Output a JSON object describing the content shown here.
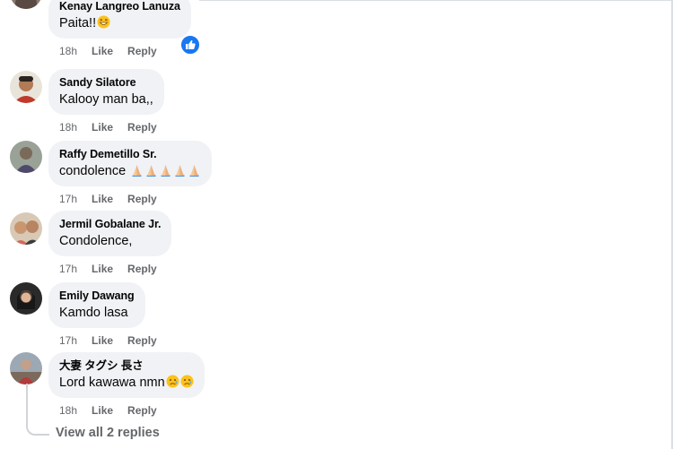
{
  "comments": [
    {
      "author": "Kenay Langreo Lanuza",
      "text": "Paita!!",
      "emoji": "grinning-sweat",
      "time": "18h",
      "like": "Like",
      "reply": "Reply",
      "reaction": "like-reaction"
    },
    {
      "author": "Sandy Silatore",
      "text": "Kalooy man ba,,",
      "time": "18h",
      "like": "Like",
      "reply": "Reply"
    },
    {
      "author": "Raffy Demetillo Sr.",
      "text": "condolence",
      "emoji": "folded-hands x5",
      "time": "17h",
      "like": "Like",
      "reply": "Reply"
    },
    {
      "author": "Jermil Gobalane Jr.",
      "text": "Condolence,",
      "time": "17h",
      "like": "Like",
      "reply": "Reply"
    },
    {
      "author": "Emily Dawang",
      "text": "Kamdo lasa",
      "time": "17h",
      "like": "Like",
      "reply": "Reply"
    },
    {
      "author": "大妻 タグシ 長さ",
      "text": "Lord kawawa nmn",
      "emoji": "sad-face x2",
      "time": "18h",
      "like": "Like",
      "reply": "Reply"
    }
  ],
  "view_replies": "View all 2 replies",
  "colors": {
    "bubble": "#f0f2f5",
    "meta": "#65676b",
    "text": "#050505",
    "accent": "#1877f2"
  }
}
